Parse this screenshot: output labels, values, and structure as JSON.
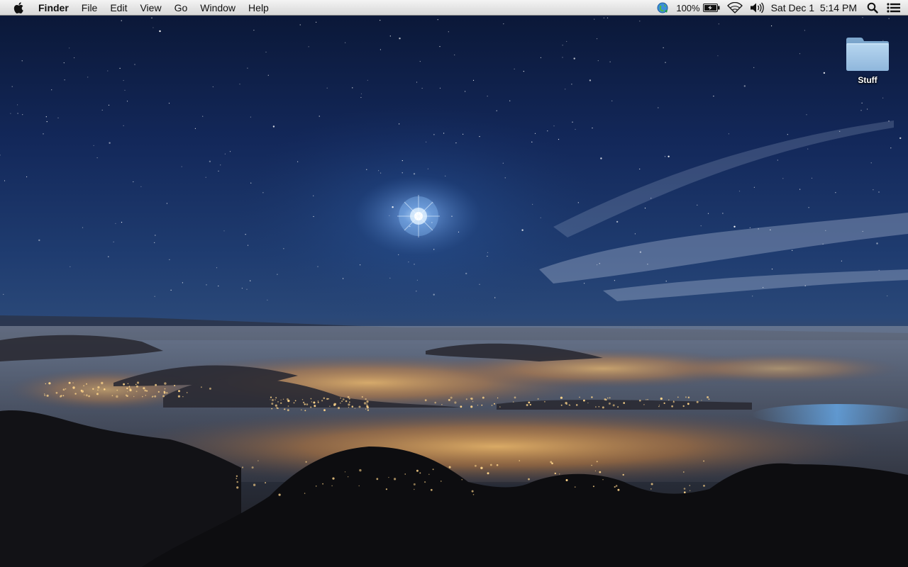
{
  "menubar": {
    "apple_icon": "apple-icon",
    "app_name": "Finder",
    "menus": [
      "File",
      "Edit",
      "View",
      "Go",
      "Window",
      "Help"
    ],
    "status": {
      "sync_icon": "sync-globe-icon",
      "battery_percent": "100%",
      "battery_icon": "battery-charging-icon",
      "wifi_icon": "wifi-icon",
      "volume_icon": "volume-icon",
      "clock": "Sat Dec 1  5:14 PM",
      "spotlight_icon": "search-icon",
      "notification_icon": "notification-center-icon"
    }
  },
  "desktop": {
    "icons": [
      {
        "label": "Stuff",
        "icon": "folder-icon"
      }
    ]
  },
  "colors": {
    "menubar_top": "#f4f4f4",
    "menubar_bottom": "#d8d8d8",
    "sky_top": "#0c1a3c",
    "sky_mid": "#1d3a6d",
    "city_glow": "#f2a24a",
    "folder_blue": "#9fc3e3"
  }
}
